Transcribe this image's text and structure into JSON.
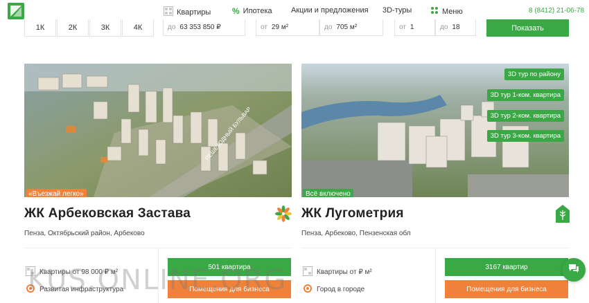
{
  "header": {
    "nav": [
      {
        "label": "Квартиры",
        "icon": "grid-icon"
      },
      {
        "label": "Ипотека",
        "icon": "percent-icon"
      },
      {
        "label": "Акции и предложения",
        "icon": ""
      },
      {
        "label": "3D-туры",
        "icon": ""
      },
      {
        "label": "Меню",
        "icon": "dots-icon"
      }
    ],
    "phone": "8 (8412) 21-06-78"
  },
  "filters": {
    "rooms": [
      "1К",
      "2К",
      "3К",
      "4К"
    ],
    "price_prefix": "до",
    "price_value": "63 353 850 ₽",
    "area_from_prefix": "от",
    "area_from_value": "29 м²",
    "area_to_prefix": "до",
    "area_to_value": "705 м²",
    "floor_from_prefix": "от",
    "floor_from_value": "1",
    "floor_to_prefix": "до",
    "floor_to_value": "18",
    "show_button": "Показать"
  },
  "cards": [
    {
      "badge": "«Въезжай легко»",
      "title": "ЖК Арбековская Застава",
      "address": "Пенза, Октябрьский район, Арбеково",
      "feature1": "Квартиры от 98 000 ₽ м²",
      "feature2": "Развитая инфраструктура",
      "green_button": "501 квартира",
      "orange_button": "Помещения для бизнеса",
      "image_labels": [
        "ПЕШЕХОДНЫЙ БУЛЬВАР"
      ]
    },
    {
      "badge": "Всё включено",
      "title": "ЖК Лугометрия",
      "address": "Пенза, Арбеково, Пензенская обл",
      "feature1": "Квартиры от ₽ м²",
      "feature2": "Город в городе",
      "green_button": "3167 квартир",
      "orange_button": "Помещения для бизнеса",
      "tours": [
        "3D тур по району",
        "3D тур 1-ком. квартира",
        "3D тур 2-ком. квартира",
        "3D тур 3-ком. квартира"
      ]
    }
  ],
  "watermark": "KUS.ONLINE.ORG",
  "colors": {
    "green": "#3aa845",
    "orange": "#f0813a"
  }
}
